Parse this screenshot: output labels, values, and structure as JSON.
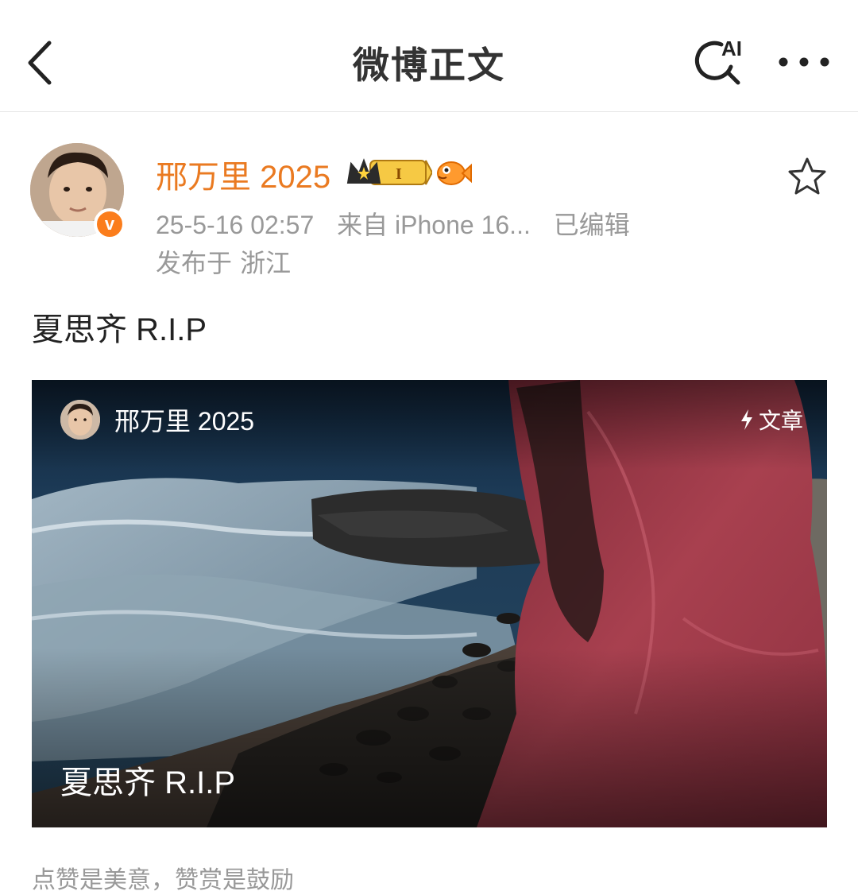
{
  "nav": {
    "title": "微博正文",
    "ai_label": "AI",
    "back_icon": "chevron-left-icon",
    "search_icon": "ai-search-icon",
    "more_icon": "more-dots-icon"
  },
  "author": {
    "name": "邢万里 2025",
    "verified_badge": "v",
    "timestamp": "25-5-16 02:57",
    "source": "来自 iPhone 16...",
    "edited": "已编辑",
    "location": "发布于 浙江"
  },
  "post": {
    "text": "夏思齐 R.I.P"
  },
  "article_card": {
    "author_name": "邢万里 2025",
    "tag": "文章",
    "title": "夏思齐 R.I.P"
  },
  "footer": {
    "reward_note": "点赞是美意，赞赏是鼓励"
  },
  "colors": {
    "username": "#ea7a21",
    "meta": "#999999",
    "verified": "#fb7d1c"
  }
}
